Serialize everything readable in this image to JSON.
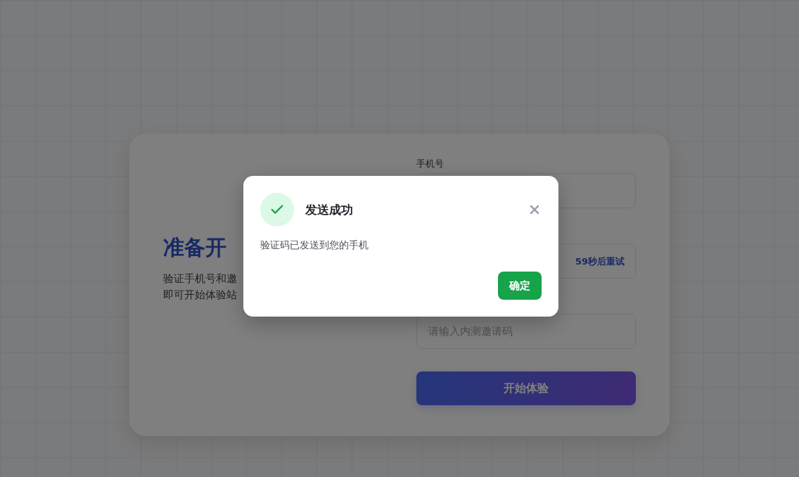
{
  "page": {
    "heading": "准备开",
    "description_lines": [
      "验证手机号和邀",
      "即可开始体验站"
    ],
    "form": {
      "fields": [
        {
          "kind": "text",
          "label": "手机号"
        },
        {
          "kind": "code",
          "action": "59秒后重试"
        },
        {
          "kind": "text",
          "placeholder": "请输入内测邀请码"
        }
      ],
      "submit": "开始体验"
    }
  },
  "dialog": {
    "title": "发送成功",
    "message": "验证码已发送到您的手机",
    "confirm": "确定"
  }
}
